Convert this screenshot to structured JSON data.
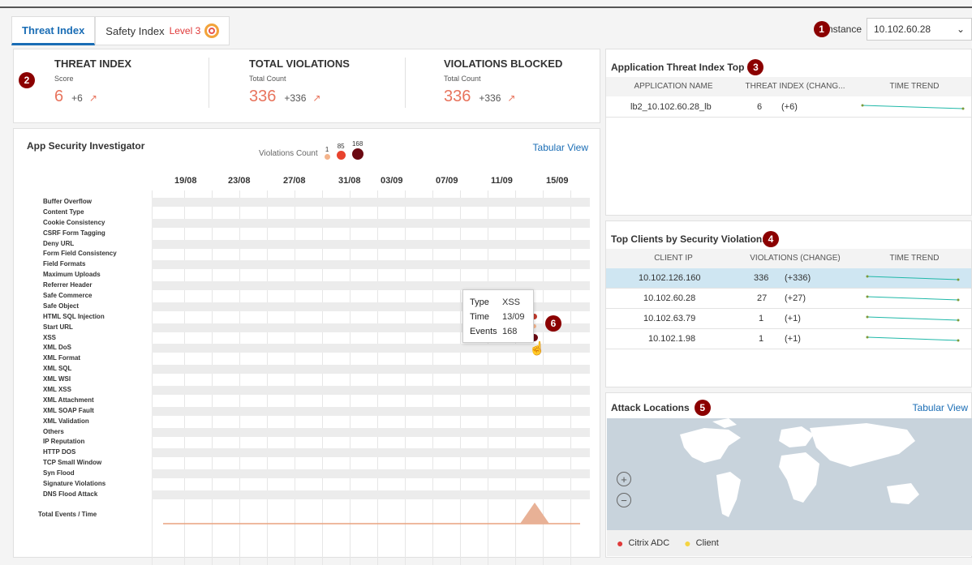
{
  "tabs": [
    {
      "label": "Threat Index",
      "active": true
    },
    {
      "label": "Safety Index",
      "level": "Level 3"
    }
  ],
  "instance": {
    "badge": "1",
    "label": "Instance",
    "value": "10.102.60.28"
  },
  "summary": {
    "badge": "2",
    "metrics": [
      {
        "title": "THREAT INDEX",
        "sub": "Score",
        "value": "6",
        "change": "+6"
      },
      {
        "title": "TOTAL VIOLATIONS",
        "sub": "Total Count",
        "value": "336",
        "change": "+336"
      },
      {
        "title": "VIOLATIONS BLOCKED",
        "sub": "Total Count",
        "value": "336",
        "change": "+336"
      }
    ]
  },
  "investigator": {
    "title": "App Security Investigator",
    "violations_count_label": "Violations Count",
    "scale": [
      "1",
      "85",
      "168"
    ],
    "tabular_view": "Tabular View",
    "dates": [
      "19/08",
      "23/08",
      "27/08",
      "31/08",
      "03/09",
      "07/09",
      "11/09",
      "15/09"
    ],
    "violation_types": [
      "Buffer Overflow",
      "Content Type",
      "Cookie Consistency",
      "CSRF Form Tagging",
      "Deny URL",
      "Form Field Consistency",
      "Field Formats",
      "Maximum Uploads",
      "Referrer Header",
      "Safe Commerce",
      "Safe Object",
      "HTML SQL Injection",
      "Start URL",
      "XSS",
      "XML DoS",
      "XML Format",
      "XML SQL",
      "XML WSI",
      "XML XSS",
      "XML Attachment",
      "XML SOAP Fault",
      "XML Validation",
      "Others",
      "IP Reputation",
      "HTTP DOS",
      "TCP Small Window",
      "Syn Flood",
      "Signature Violations",
      "DNS Flood Attack"
    ],
    "total_label": "Total Events / Time",
    "tooltip": {
      "type_label": "Type",
      "type": "XSS",
      "time_label": "Time",
      "time": "13/09",
      "events_label": "Events",
      "events": "168"
    },
    "tooltip_badge": "6"
  },
  "app_threat": {
    "title": "Application Threat Index Top 5",
    "badge": "3",
    "columns": [
      "APPLICATION NAME",
      "THREAT INDEX (CHANG...",
      "TIME TREND"
    ],
    "rows": [
      {
        "name": "lb2_10.102.60.28_lb",
        "index": "6",
        "change": "(+6)"
      }
    ]
  },
  "top_clients": {
    "title": "Top Clients by Security Violations",
    "badge": "4",
    "columns": [
      "CLIENT IP",
      "VIOLATIONS (CHANGE)",
      "TIME TREND"
    ],
    "rows": [
      {
        "ip": "10.102.126.160",
        "count": "336",
        "change": "(+336)",
        "selected": true
      },
      {
        "ip": "10.102.60.28",
        "count": "27",
        "change": "(+27)"
      },
      {
        "ip": "10.102.63.79",
        "count": "1",
        "change": "(+1)"
      },
      {
        "ip": "10.102.1.98",
        "count": "1",
        "change": "(+1)"
      }
    ]
  },
  "attack_locations": {
    "title": "Attack Locations",
    "badge": "5",
    "tabular_view": "Tabular View",
    "legend": [
      "Citrix ADC",
      "Client"
    ]
  },
  "colors": {
    "accent": "#1a6db5",
    "badge": "#8b0000",
    "value": "#e8745d",
    "trend": "#1fb8a8"
  }
}
